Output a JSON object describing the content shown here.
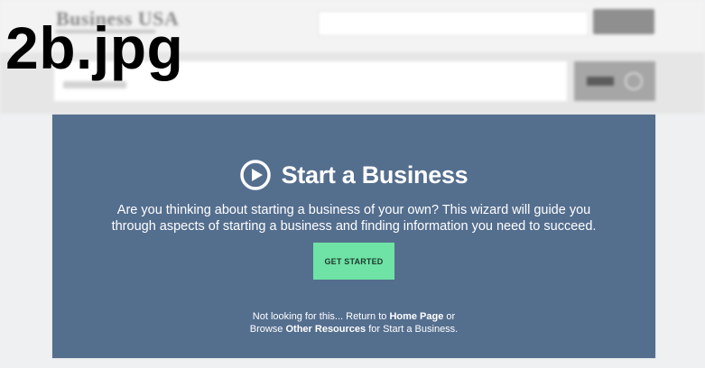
{
  "overlay": {
    "filename": "2b.jpg"
  },
  "background": {
    "logo_text": "Business USA"
  },
  "panel": {
    "icon": "play-circle-icon",
    "title": "Start a Business",
    "description": "Are you thinking about starting a business of your own? This wizard will guide you through aspects of starting a business and finding information you need to succeed.",
    "cta_label": "GET STARTED",
    "footer": {
      "line1_prefix": "Not looking for this... Return to ",
      "home_link": "Home Page",
      "line1_suffix": " or",
      "line2_prefix": "Browse ",
      "resources_link": "Other Resources",
      "line2_suffix": " for Start a Business."
    }
  },
  "colors": {
    "panel_bg": "#546e8e",
    "cta_bg": "#6fe3a6",
    "text": "#ffffff"
  }
}
